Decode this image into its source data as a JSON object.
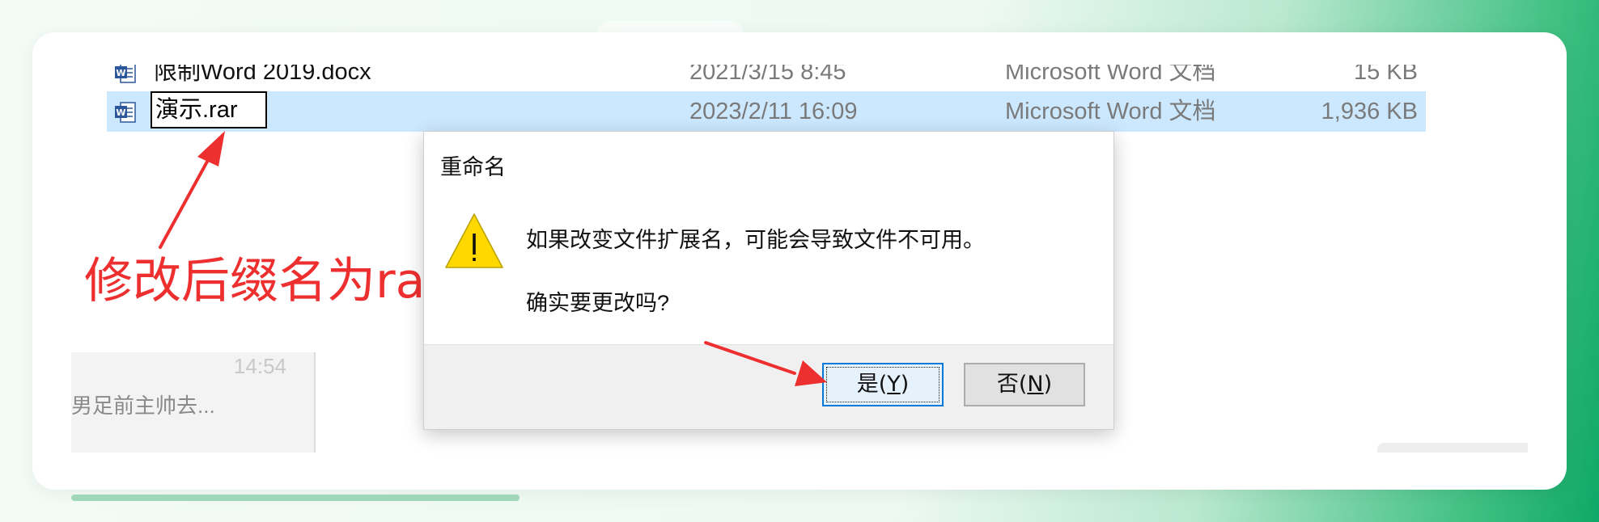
{
  "files": [
    {
      "name": "限制Word 2019.docx",
      "date": "2021/3/15 8:45",
      "type": "Microsoft Word 文档",
      "size": "15 KB",
      "icon": "word-document-icon"
    },
    {
      "name": "演示.rar",
      "date": "2023/2/11 16:09",
      "type": "Microsoft Word 文档",
      "size": "1,936 KB",
      "icon": "word-document-icon",
      "selected": true
    }
  ],
  "annotation": {
    "text": "修改后缀名为rar",
    "color": "#ee2f2f"
  },
  "lower_pane": {
    "time": "14:54",
    "text": "男足前主帅去..."
  },
  "dialog": {
    "title": "重命名",
    "icon": "warning-icon",
    "message": "如果改变文件扩展名，可能会导致文件不可用。",
    "question": "确实要更改吗?",
    "buttons": {
      "yes_prefix": "是(",
      "yes_key": "Y",
      "yes_suffix": ")",
      "no_prefix": "否(",
      "no_key": "N",
      "no_suffix": ")"
    }
  },
  "colors": {
    "selection": "#cce8ff",
    "focus_border": "#0078d7",
    "warning_yellow": "#ffd800"
  }
}
